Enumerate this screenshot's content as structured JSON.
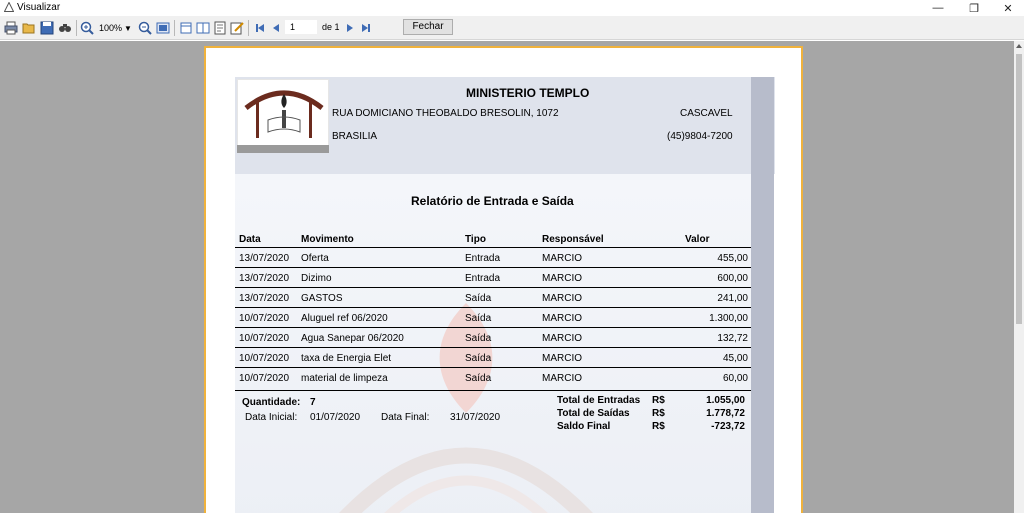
{
  "window": {
    "title": "Visualizar",
    "minimize": "—",
    "restore": "❐",
    "close": "✕"
  },
  "toolbar": {
    "zoom": "100%",
    "page_number": "1",
    "page_of": "de 1",
    "close_label": "Fechar"
  },
  "report": {
    "org_name": "MINISTERIO TEMPLO",
    "address": "RUA DOMICIANO THEOBALDO BRESOLIN, 1072",
    "city": "CASCAVEL",
    "state": "BRASILIA",
    "phone": "(45)9804-7200",
    "title": "Relatório de Entrada e Saída",
    "columns": [
      "Data",
      "Movimento",
      "Tipo",
      "Responsável",
      "Valor"
    ],
    "rows": [
      {
        "date": "13/07/2020",
        "mov": "Oferta",
        "tipo": "Entrada",
        "resp": "MARCIO",
        "valor": "455,00"
      },
      {
        "date": "13/07/2020",
        "mov": "Dizimo",
        "tipo": "Entrada",
        "resp": "MARCIO",
        "valor": "600,00"
      },
      {
        "date": "13/07/2020",
        "mov": "GASTOS",
        "tipo": "Saída",
        "resp": "MARCIO",
        "valor": "241,00"
      },
      {
        "date": "10/07/2020",
        "mov": "Aluguel ref 06/2020",
        "tipo": "Saída",
        "resp": "MARCIO",
        "valor": "1.300,00"
      },
      {
        "date": "10/07/2020",
        "mov": "Agua Sanepar 06/2020",
        "tipo": "Saída",
        "resp": "MARCIO",
        "valor": "132,72"
      },
      {
        "date": "10/07/2020",
        "mov": "taxa de Energia Elet",
        "tipo": "Saída",
        "resp": "MARCIO",
        "valor": "45,00"
      },
      {
        "date": "10/07/2020",
        "mov": "material de limpeza",
        "tipo": "Saída",
        "resp": "MARCIO",
        "valor": "60,00"
      }
    ],
    "summary": {
      "qty_label": "Quantidade:",
      "qty_value": "7",
      "start_label": "Data Inicial:",
      "start_value": "01/07/2020",
      "end_label": "Data Final:",
      "end_value": "31/07/2020",
      "totals": [
        {
          "label": "Total de Entradas",
          "currency": "R$",
          "value": "1.055,00"
        },
        {
          "label": "Total de Saídas",
          "currency": "R$",
          "value": "1.778,72"
        },
        {
          "label": "Saldo Final",
          "currency": "R$",
          "value": "-723,72"
        }
      ]
    }
  }
}
